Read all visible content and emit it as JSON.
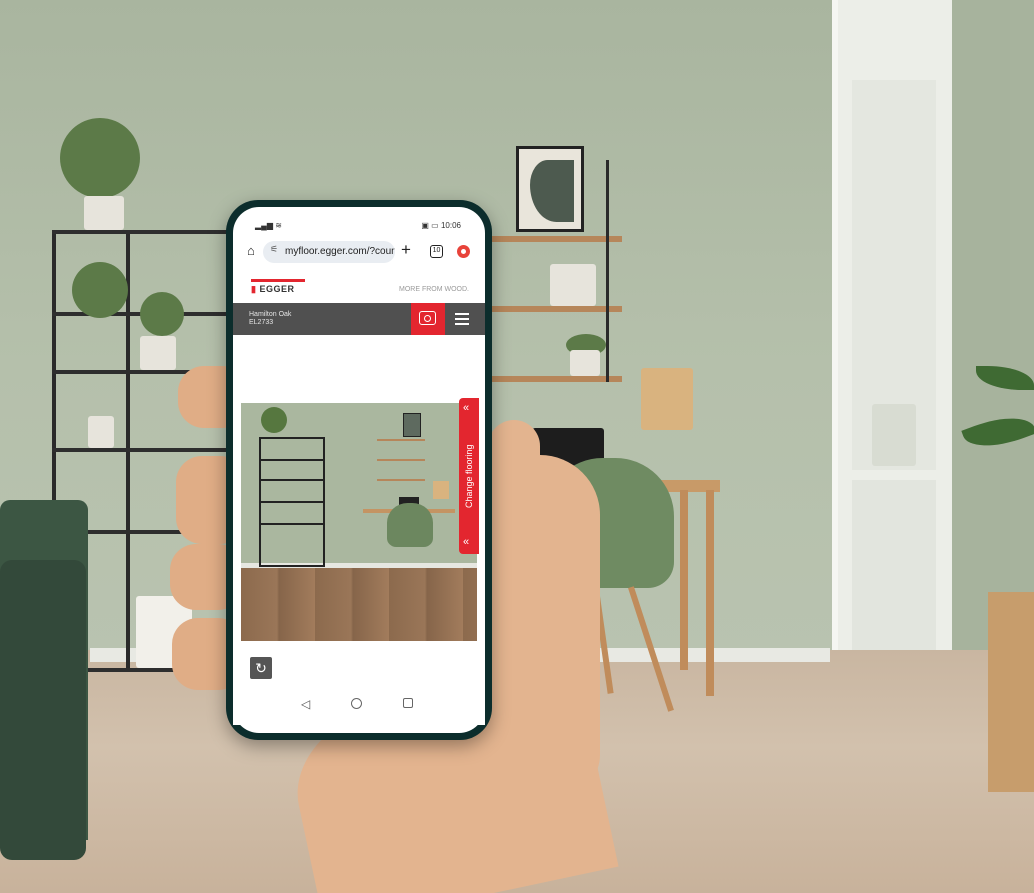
{
  "status_bar": {
    "left_icons": "▂▄▆ ≋",
    "right_icons": "▣ ▭",
    "time": "10:06"
  },
  "browser": {
    "home_icon": "home-icon",
    "url": "myfloor.egger.com/?count",
    "new_tab_icon": "plus-icon",
    "tabs_count": "10",
    "extension_icon": "record-icon"
  },
  "header": {
    "logo_text": "EGGER",
    "tagline": "MORE FROM WOOD."
  },
  "decor": {
    "name": "Hamilton Oak",
    "code": "EL2733",
    "camera_icon": "camera-icon",
    "menu_icon": "hamburger-menu-icon"
  },
  "side_tab": {
    "label": "Change flooring"
  },
  "reset_icon": "rotate-reset-icon",
  "android_nav": {
    "back": "◁",
    "home": "home-circle-icon",
    "recent": "recent-square-icon"
  },
  "colors": {
    "brand_red": "#e3262f",
    "decor_bar": "#505050",
    "phone_body": "#0c2d2c"
  }
}
